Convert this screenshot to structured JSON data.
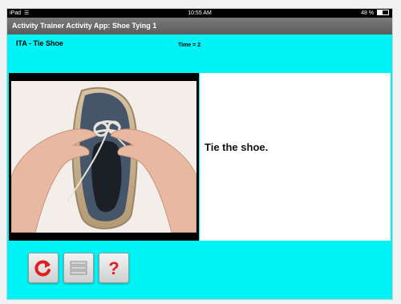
{
  "status_bar": {
    "device": "iPad",
    "time": "10:55 AM",
    "battery": "48 %",
    "battery_fill": 0.48
  },
  "titlebar": {
    "title": "Activity Trainer Activity App: Shoe Tying 1"
  },
  "activity": {
    "name": "ITA - Tie Shoe",
    "timer": "Time = 2"
  },
  "instruction": {
    "text": "Tie the shoe."
  },
  "buttons": [
    {
      "name": "restart-button",
      "icon": "refresh-icon"
    },
    {
      "name": "list-button",
      "icon": "list-icon"
    },
    {
      "name": "help-button",
      "icon": "question-mark-icon"
    }
  ],
  "colors": {
    "background": "#00f4f6",
    "accent_red": "#e0201f",
    "titlebar": "#6b6b6b"
  }
}
